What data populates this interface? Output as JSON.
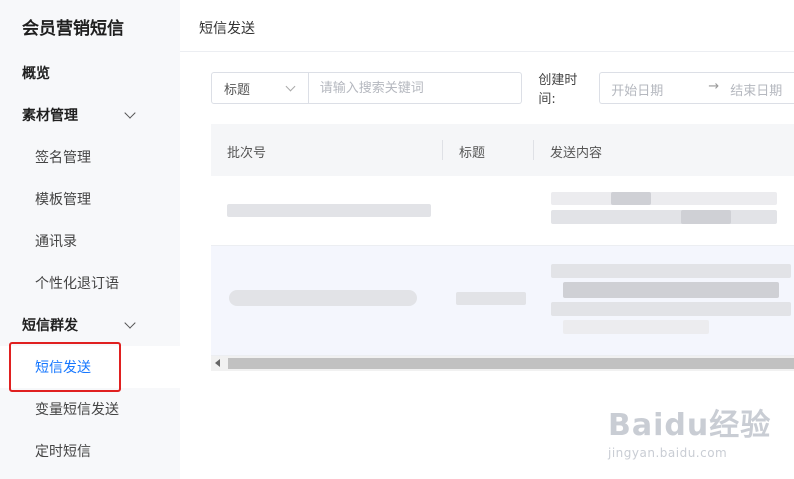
{
  "sidebar": {
    "app_title": "会员营销短信",
    "items": [
      {
        "label": "概览",
        "level": "group"
      },
      {
        "label": "素材管理",
        "level": "group",
        "expandable": true
      },
      {
        "label": "签名管理",
        "level": "sub"
      },
      {
        "label": "模板管理",
        "level": "sub"
      },
      {
        "label": "通讯录",
        "level": "sub"
      },
      {
        "label": "个性化退订语",
        "level": "sub"
      },
      {
        "label": "短信群发",
        "level": "group",
        "expandable": true
      },
      {
        "label": "短信发送",
        "level": "sub",
        "active": true
      },
      {
        "label": "变量短信发送",
        "level": "sub"
      },
      {
        "label": "定时短信",
        "level": "sub"
      }
    ]
  },
  "header": {
    "title": "短信发送"
  },
  "filter": {
    "field_select": "标题",
    "search_placeholder": "请输入搜索关键词",
    "date_label": "创建时间:",
    "date_start_placeholder": "开始日期",
    "date_arrow": "→",
    "date_end_placeholder": "结束日期"
  },
  "table": {
    "columns": [
      "批次号",
      "标题",
      "发送内容"
    ]
  },
  "watermark": {
    "logo": "Baidu经验",
    "sub": "jingyan.baidu.com"
  },
  "colors": {
    "accent": "#1677ff",
    "highlight": "#e02020",
    "sidebar_bg": "#f7f8fa"
  }
}
